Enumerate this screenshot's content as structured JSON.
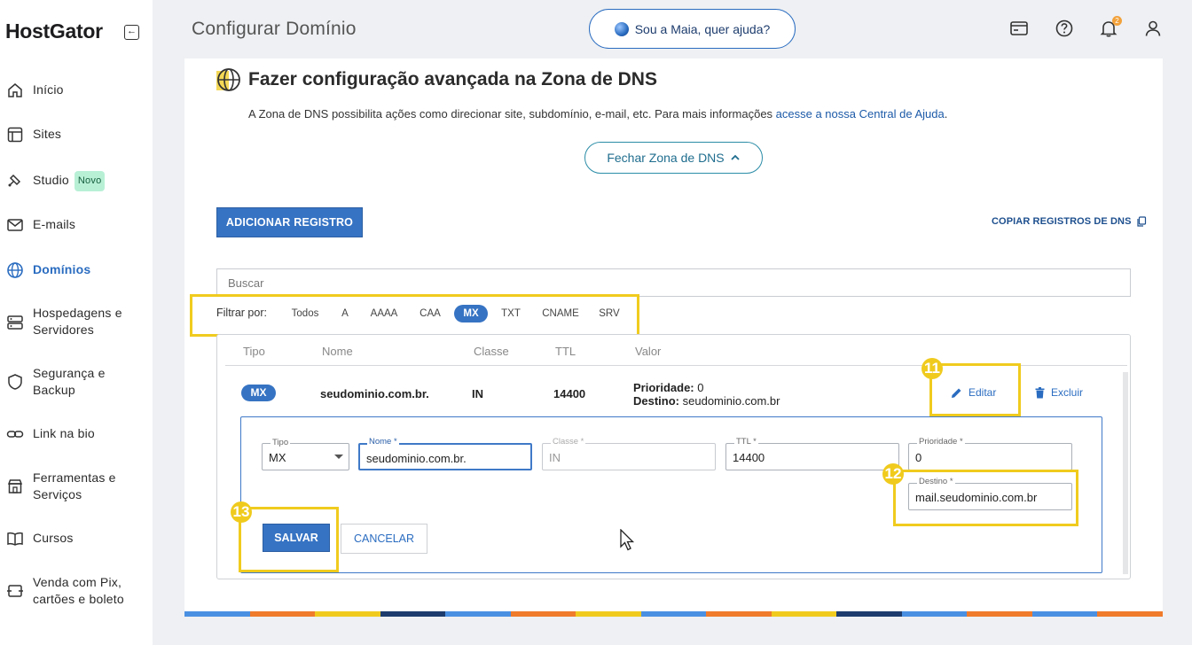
{
  "app": {
    "logo": "HostGator",
    "collapse_icon": "collapse-sidebar-icon"
  },
  "sidebar": {
    "items": [
      {
        "label": "Início",
        "icon": "home-icon"
      },
      {
        "label": "Sites",
        "icon": "layout-icon"
      },
      {
        "label": "Studio",
        "icon": "studio-icon",
        "badge": "Novo"
      },
      {
        "label": "E-mails",
        "icon": "mail-icon"
      },
      {
        "label": "Domínios",
        "icon": "globe-icon",
        "active": true
      },
      {
        "label": "Hospedagens e",
        "label2": "Servidores",
        "icon": "server-icon"
      },
      {
        "label": "Segurança e",
        "label2": "Backup",
        "icon": "shield-icon"
      },
      {
        "label": "Link na bio",
        "icon": "link-icon"
      },
      {
        "label": "Ferramentas e",
        "label2": "Serviços",
        "icon": "store-icon"
      },
      {
        "label": "Cursos",
        "icon": "book-icon"
      },
      {
        "label": "Venda com Pix,",
        "label2": "cartões e boleto",
        "icon": "payment-icon"
      }
    ]
  },
  "header": {
    "title": "Configurar Domínio",
    "help_button": "Sou a Maia, quer ajuda?",
    "notifications_count": "2"
  },
  "dns": {
    "title": "Fazer configuração avançada na Zona de DNS",
    "description": "A Zona de DNS possibilita ações como direcionar site, subdomínio, e-mail, etc. Para mais informações ",
    "help_link": "acesse a nossa Central de Ajuda",
    "description_end": ".",
    "close_button": "Fechar Zona de DNS",
    "add_button": "ADICIONAR REGISTRO",
    "copy_button": "COPIAR REGISTROS DE DNS",
    "search_placeholder": "Buscar",
    "filter_label": "Filtrar por:",
    "filters": [
      "Todos",
      "A",
      "AAAA",
      "CAA",
      "MX",
      "TXT",
      "CNAME",
      "SRV"
    ],
    "active_filter": "MX"
  },
  "table": {
    "headers": [
      "Tipo",
      "Nome",
      "Classe",
      "TTL",
      "Valor"
    ],
    "row": {
      "type": "MX",
      "name": "seudominio.com.br.",
      "class": "IN",
      "ttl": "14400",
      "priority_label": "Prioridade:",
      "priority_value": "0",
      "destination_label": "Destino:",
      "destination_value": "seudominio.com.br",
      "edit": "Editar",
      "delete": "Excluir"
    }
  },
  "edit_form": {
    "tipo_label": "Tipo",
    "tipo_value": "MX",
    "nome_label": "Nome *",
    "nome_value": "seudominio.com.br.",
    "classe_label": "Classe *",
    "classe_value": "IN",
    "ttl_label": "TTL *",
    "ttl_value": "14400",
    "prioridade_label": "Prioridade *",
    "prioridade_value": "0",
    "destino_label": "Destino *",
    "destino_value": "mail.seudominio.com.br",
    "save": "SALVAR",
    "cancel": "CANCELAR"
  },
  "annotations": {
    "step_edit": "11",
    "step_destination": "12",
    "step_save": "13"
  },
  "colors": {
    "accent": "#3673c3",
    "highlight": "#f0cb1e",
    "active_nav": "#2a6cc0"
  }
}
